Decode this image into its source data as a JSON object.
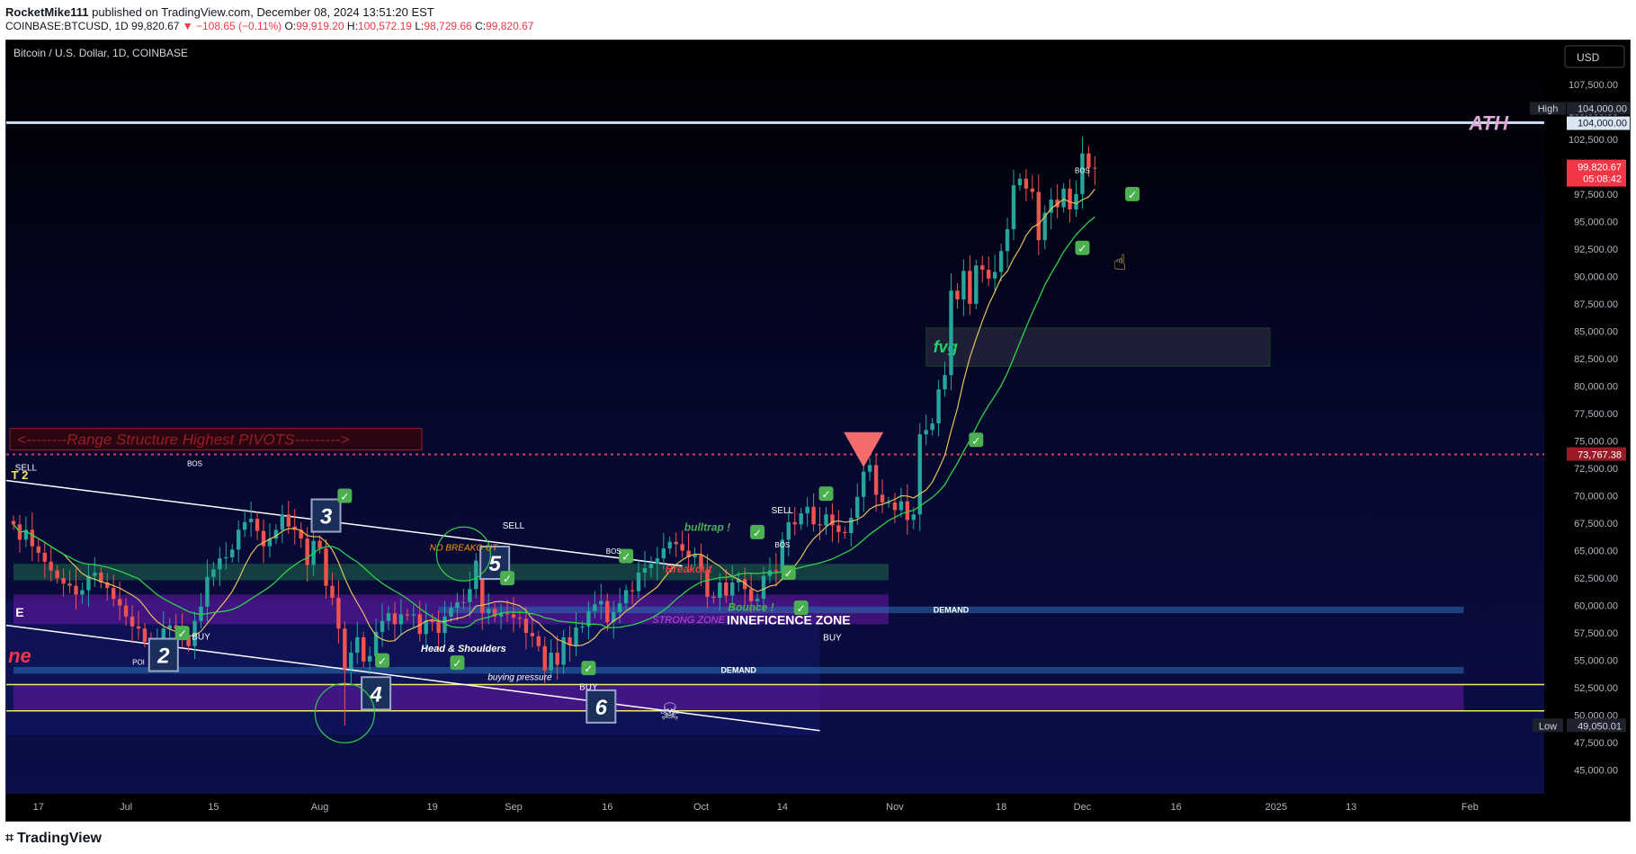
{
  "header": {
    "author": "RocketMike111",
    "published_text": "published on TradingView.com, December 08, 2024 13:51:20 EST",
    "symbol_line": "COINBASE:BTCUSD, 1D",
    "last_price": "99,820.67",
    "change": "▼ −108.65 (−0.11%)",
    "open_label": "O:",
    "open": "99,919.20",
    "high_label": "H:",
    "high": "100,572.19",
    "low_label": "L:",
    "low": "98,729.66",
    "close_label": "C:",
    "close": "99,820.67"
  },
  "chart_title": "Bitcoin / U.S. Dollar, 1D, COINBASE",
  "currency_button": "USD",
  "footer": {
    "brand": "TradingView"
  },
  "colors": {
    "background": "#0a0c33",
    "up": "#26a69a",
    "down": "#ef5350",
    "ath_line": "#c8d8f0",
    "range_line": "#f23645",
    "label_red": "#f26c6c"
  },
  "chart_data": {
    "type": "candlestick",
    "symbol": "BTCUSD",
    "interval": "1D",
    "ylim": [
      43500,
      111500
    ],
    "y_ticks": [
      45000,
      47500,
      50000,
      52500,
      55000,
      57500,
      60000,
      62500,
      65000,
      67500,
      70000,
      72500,
      75000,
      77500,
      80000,
      82500,
      85000,
      87500,
      90000,
      92500,
      95000,
      97500,
      100000,
      102500,
      105000,
      107500
    ],
    "y_tick_labels": [
      "45,000.00",
      "47,500.00",
      "50,000.00",
      "52,500.00",
      "55,000.00",
      "57,500.00",
      "60,000.00",
      "62,500.00",
      "65,000.00",
      "67,500.00",
      "70,000.00",
      "72,500.00",
      "75,000.00",
      "77,500.00",
      "80,000.00",
      "82,500.00",
      "85,000.00",
      "87,500.00",
      "90,000.00",
      "92,500.00",
      "95,000.00",
      "97,500.00",
      "100,000.00",
      "102,500.00",
      "105,000.00",
      "107,500.00"
    ],
    "x_tick_labels": [
      "17",
      "Jul",
      "15",
      "Aug",
      "19",
      "Sep",
      "16",
      "Oct",
      "14",
      "Nov",
      "18",
      "Dec",
      "16",
      "2025",
      "13",
      "Feb"
    ],
    "x_tick_dates": [
      "2024-06-17",
      "2024-07-01",
      "2024-07-15",
      "2024-08-01",
      "2024-08-19",
      "2024-09-01",
      "2024-09-16",
      "2024-10-01",
      "2024-10-14",
      "2024-11-01",
      "2024-11-18",
      "2024-12-01",
      "2024-12-16",
      "2025-01-01",
      "2025-01-13",
      "2025-02-01"
    ],
    "first_date": "2024-06-13",
    "last_date": "2024-12-08",
    "closes": [
      67400,
      66000,
      66900,
      65400,
      64800,
      64000,
      63200,
      62500,
      62000,
      61800,
      61000,
      61400,
      62700,
      63000,
      62100,
      61600,
      60600,
      60000,
      59000,
      58100,
      57900,
      56700,
      56200,
      56700,
      57900,
      58200,
      57900,
      57200,
      56300,
      58600,
      59900,
      62600,
      63300,
      64300,
      64400,
      65100,
      66900,
      67600,
      67900,
      66800,
      65400,
      66100,
      66900,
      68300,
      67200,
      66900,
      66100,
      63700,
      65900,
      65200,
      61800,
      60700,
      57900,
      54200,
      55700,
      57100,
      54900,
      55400,
      57600,
      58600,
      59300,
      58300,
      59200,
      59100,
      59200,
      57400,
      58600,
      58500,
      57500,
      59000,
      59800,
      60300,
      60300,
      61500,
      64100,
      59300,
      59700,
      59000,
      59300,
      59200,
      58900,
      58800,
      57500,
      57200,
      56300,
      54100,
      55700,
      54600,
      57100,
      56400,
      58000,
      58100,
      59500,
      60100,
      60400,
      58500,
      59400,
      60200,
      61400,
      61300,
      63000,
      63400,
      63800,
      64300,
      65200,
      65800,
      65600,
      65000,
      64400,
      64600,
      63300,
      60800,
      60700,
      62100,
      60900,
      62100,
      62400,
      61500,
      60400,
      60600,
      62700,
      63200,
      63100,
      66000,
      67600,
      67400,
      68400,
      69000,
      67400,
      67300,
      68300,
      67300,
      66700,
      66600,
      68000,
      69900,
      72200,
      72800,
      70100,
      69400,
      69400,
      68700,
      69500,
      67800,
      68300,
      75600,
      76000,
      76600,
      79700,
      81000,
      88700,
      87900,
      90500,
      87500,
      91000,
      90600,
      89800,
      90400,
      92300,
      94300,
      98300,
      98900,
      98000,
      97700,
      93300,
      95800,
      97000,
      96300,
      98000,
      96100,
      97500,
      101200,
      99900,
      99820
    ],
    "highs_special": {
      "2024-12-05": 104000,
      "2024-12-04": 99100
    },
    "ath": 104000,
    "ath_label": "ATH",
    "high_label": "High",
    "high_value_label": "104,000.00",
    "ath_price_label": "104,000.00",
    "low_label": "Low",
    "low_value": 49050.01,
    "low_value_label": "49,050.01",
    "last_price_label": "99,820.67",
    "countdown_label": "05:08:42",
    "range_pivot_value": 73767.38,
    "range_pivot_label": "73,767.38",
    "range_structure_text": "<--------Range Structure Highest PIVOTS--------->",
    "zones": [
      {
        "name": "green-zone",
        "low": 62300,
        "high": 63800,
        "from": "2024-06-13",
        "to": "2024-10-31"
      },
      {
        "name": "purple-zone",
        "low": 58300,
        "high": 61000,
        "from": "2024-06-13",
        "to": "2024-10-31"
      },
      {
        "name": "demand-zone-upper",
        "low": 59300,
        "high": 59900,
        "label": "DEMAND",
        "from": "2024-08-20",
        "to": "2025-01-31"
      },
      {
        "name": "demand-zone-lower",
        "low": 53800,
        "high": 54400,
        "label": "DEMAND",
        "from": "2024-06-13",
        "to": "2025-01-31"
      },
      {
        "name": "lower-purple-zone",
        "low": 50400,
        "high": 52800,
        "from": "2024-06-13",
        "to": "2025-01-31"
      },
      {
        "name": "fvg-zone",
        "low": 81800,
        "high": 85300,
        "label": "fvg",
        "from": "2024-11-06",
        "to": "2024-12-31"
      }
    ],
    "annotations": {
      "sell_left": "SELL",
      "sell_mid": "SELL",
      "sell_right": "SELL",
      "buy_left": "BUY",
      "buy_right": "BUY",
      "buy_mid": "BUY",
      "bos": "BOS",
      "poi": "POI",
      "t2": "T 2",
      "ne_text": "ne",
      "e_text": "E",
      "wave_2": "2",
      "wave_3": "3",
      "wave_4": "4",
      "wave_5": "5",
      "wave_6": "6",
      "no_breakout": "NO BREAKO UT",
      "head_shoulders": "Head & Shoulders",
      "buying_pressure": "buying pressure",
      "bulltrap": "bulltrap !",
      "breakout": "Breakout",
      "strong_zone": "STRONG ZONE",
      "inneficence_zone": "INNEFICENCE ZONE",
      "bounce": "Bounce !"
    }
  }
}
